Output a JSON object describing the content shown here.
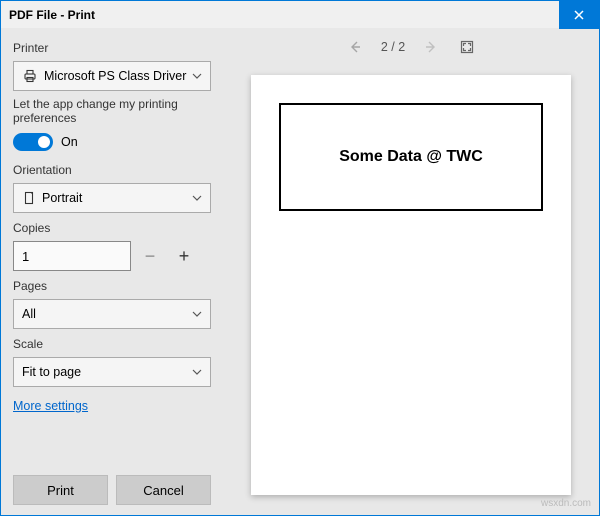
{
  "window": {
    "title": "PDF File - Print"
  },
  "sidebar": {
    "printer_label": "Printer",
    "printer_value": "Microsoft PS Class Driver",
    "toggle_note": "Let the app change my printing preferences",
    "toggle_state": "On",
    "orientation_label": "Orientation",
    "orientation_value": "Portrait",
    "copies_label": "Copies",
    "copies_value": "1",
    "pages_label": "Pages",
    "pages_value": "All",
    "scale_label": "Scale",
    "scale_value": "Fit to page",
    "more_link": "More settings"
  },
  "footer": {
    "print": "Print",
    "cancel": "Cancel"
  },
  "preview": {
    "page_indicator": "2 / 2",
    "document_text": "Some Data @ TWC"
  },
  "watermark": "wsxdn.com"
}
